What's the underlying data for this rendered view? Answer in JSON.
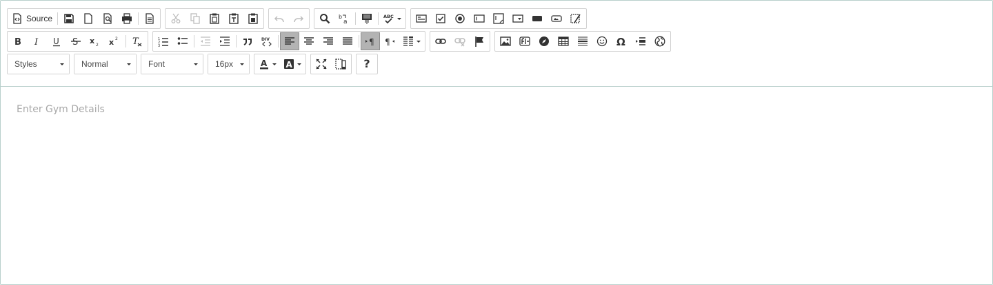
{
  "toolbar": {
    "source_label": "Source",
    "styles_value": "Styles",
    "format_value": "Normal",
    "font_value": "Font",
    "size_value": "16px",
    "help_label": "?"
  },
  "editor": {
    "placeholder": "Enter Gym Details"
  }
}
